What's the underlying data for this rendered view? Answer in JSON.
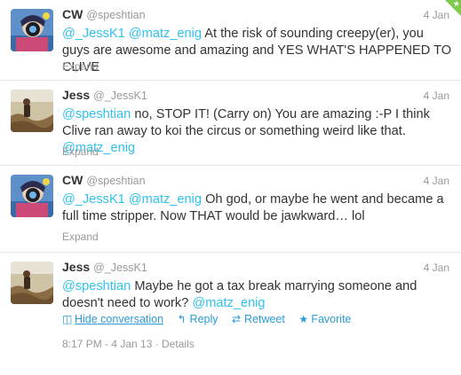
{
  "tweets": [
    {
      "name": "CW",
      "handle": "@speshtian",
      "time": "4 Jan",
      "parts": [
        {
          "t": "@_JessK1",
          "m": true
        },
        {
          "t": " "
        },
        {
          "t": "@matz_enig",
          "m": true
        },
        {
          "t": " At the risk of sounding creepy(er), you guys are awesome and amazing and YES WHAT'S HAPPENED TO CLIVE"
        }
      ],
      "expand_label": "Expand",
      "avatar": "cw"
    },
    {
      "name": "Jess",
      "handle": "@_JessK1",
      "time": "4 Jan",
      "parts": [
        {
          "t": "@speshtian",
          "m": true
        },
        {
          "t": " no, STOP IT! (Carry on) You are amazing :-P I think Clive ran away to koi the circus or something weird like that. "
        },
        {
          "t": "@matz_enig",
          "m": true
        }
      ],
      "expand_label": "Expand",
      "avatar": "jess"
    },
    {
      "name": "CW",
      "handle": "@speshtian",
      "time": "4 Jan",
      "parts": [
        {
          "t": "@_JessK1",
          "m": true
        },
        {
          "t": " "
        },
        {
          "t": "@matz_enig",
          "m": true
        },
        {
          "t": " Oh god, or maybe he went and became a full time stripper. Now THAT would be jawkward… lol"
        }
      ],
      "expand_label": "Expand",
      "avatar": "cw"
    },
    {
      "name": "Jess",
      "handle": "@_JessK1",
      "time": "4 Jan",
      "parts": [
        {
          "t": "@speshtian",
          "m": true
        },
        {
          "t": " Maybe he got a tax break marrying someone and doesn't need to work? "
        },
        {
          "t": "@matz_enig",
          "m": true
        }
      ],
      "avatar": "jess",
      "actions": {
        "hide": "Hide conversation",
        "reply": "Reply",
        "retweet": "Retweet",
        "favorite": "Favorite"
      },
      "meta": "8:17 PM - 4 Jan 13 · Details"
    }
  ],
  "colors": {
    "mention": "#2fc2ef",
    "link": "#2a9bd6",
    "muted": "#999999",
    "text": "#333333",
    "corner": "#7fc94d"
  }
}
